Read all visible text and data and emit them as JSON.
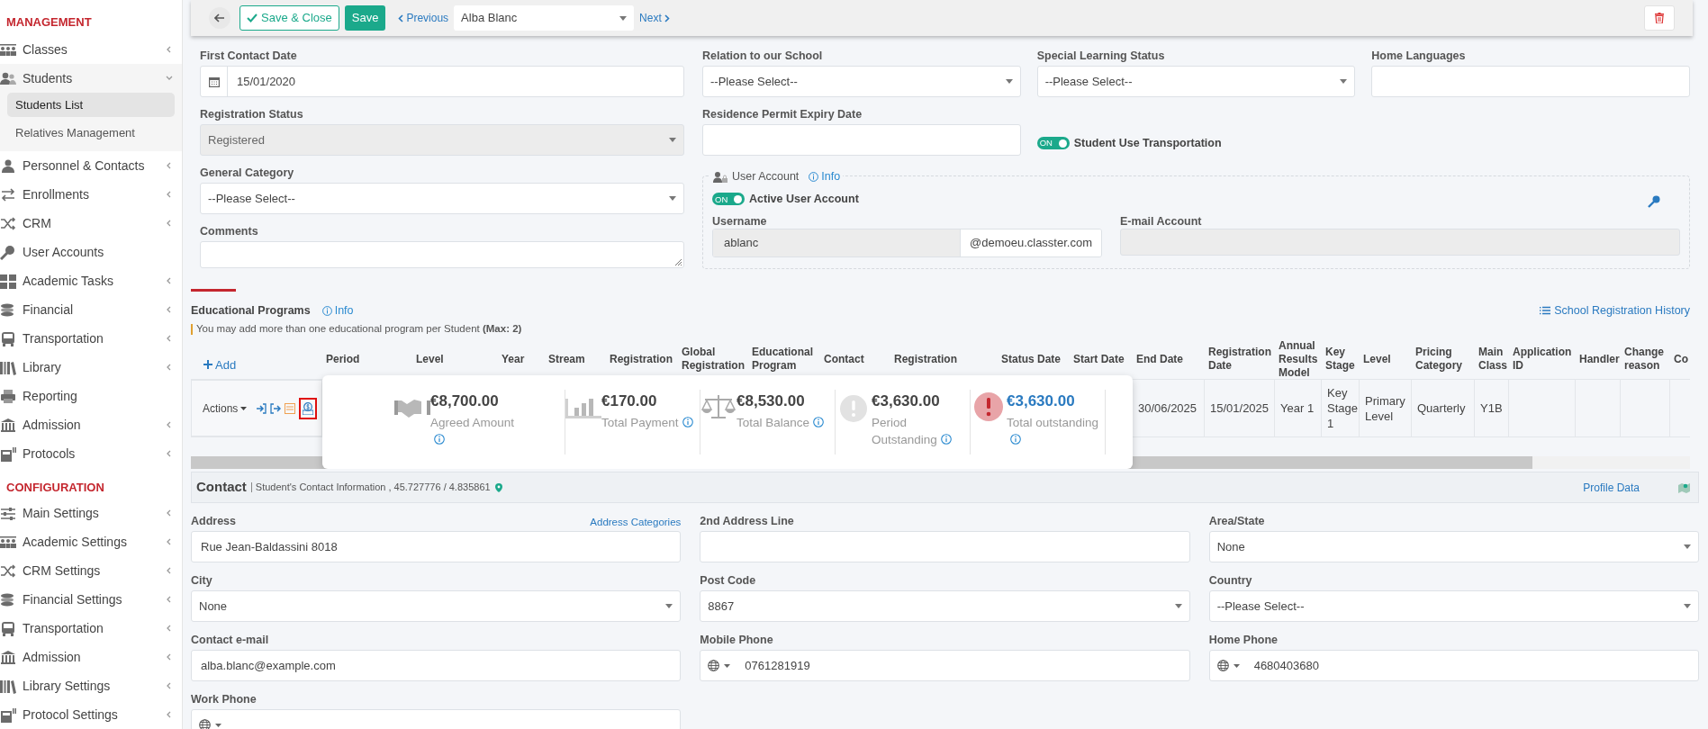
{
  "sidebar": {
    "sections": [
      {
        "heading": "MANAGEMENT",
        "items": [
          {
            "label": "Classes",
            "expandable": true,
            "expanded": false
          },
          {
            "label": "Students",
            "expandable": true,
            "expanded": true,
            "children": [
              {
                "label": "Students List",
                "selected": true
              },
              {
                "label": "Relatives Management",
                "selected": false
              }
            ]
          },
          {
            "label": "Personnel & Contacts",
            "expandable": true,
            "expanded": false
          },
          {
            "label": "Enrollments",
            "expandable": true,
            "expanded": false
          },
          {
            "label": "CRM",
            "expandable": true,
            "expanded": false
          },
          {
            "label": "User Accounts",
            "expandable": false
          },
          {
            "label": "Academic Tasks",
            "expandable": true,
            "expanded": false
          },
          {
            "label": "Financial",
            "expandable": true,
            "expanded": false
          },
          {
            "label": "Transportation",
            "expandable": true,
            "expanded": false
          },
          {
            "label": "Library",
            "expandable": true,
            "expanded": false
          },
          {
            "label": "Reporting",
            "expandable": false
          },
          {
            "label": "Admission",
            "expandable": true,
            "expanded": false
          },
          {
            "label": "Protocols",
            "expandable": true,
            "expanded": false
          }
        ]
      },
      {
        "heading": "CONFIGURATION",
        "items": [
          {
            "label": "Main Settings",
            "expandable": true,
            "expanded": false
          },
          {
            "label": "Academic Settings",
            "expandable": true,
            "expanded": false
          },
          {
            "label": "CRM Settings",
            "expandable": true,
            "expanded": false
          },
          {
            "label": "Financial Settings",
            "expandable": true,
            "expanded": false
          },
          {
            "label": "Transportation",
            "expandable": true,
            "expanded": false
          },
          {
            "label": "Admission",
            "expandable": true,
            "expanded": false
          },
          {
            "label": "Library Settings",
            "expandable": true,
            "expanded": false
          },
          {
            "label": "Protocol Settings",
            "expandable": true,
            "expanded": false
          }
        ]
      }
    ]
  },
  "toolbar": {
    "buttons": [
      {
        "label": "Save & Close",
        "kind": "outline"
      },
      {
        "label": "Save",
        "kind": "solid"
      }
    ],
    "previous": "Previous",
    "record": "Alba Blanc",
    "next": "Next"
  },
  "form": {
    "left": [
      {
        "label": "First Contact Date",
        "kind": "date",
        "value": "15/01/2020",
        "disabled": false
      },
      {
        "label": "Registration Status",
        "kind": "select",
        "value": "Registered",
        "disabled": true
      },
      {
        "label": "General Category",
        "kind": "select",
        "value": "--Please Select--",
        "disabled": false
      },
      {
        "label": "Comments",
        "kind": "textarea",
        "disabled": false
      }
    ],
    "row1": [
      {
        "label": "Relation to our School",
        "kind": "select",
        "value": "--Please Select--"
      },
      {
        "label": "Special Learning Status",
        "kind": "select",
        "value": "--Please Select--"
      },
      {
        "label": "Home Languages",
        "kind": "text"
      }
    ],
    "row2": [
      {
        "label": "Residence Permit Expiry Date",
        "kind": "text"
      },
      {
        "label": "Student Use Transportation",
        "kind": "toggle",
        "on": true,
        "toggle_text": "ON"
      }
    ],
    "user_account": {
      "legend": "User Account",
      "info": "Info",
      "active_label": "Active User Account",
      "active_on": true,
      "active_text": "ON",
      "username_label": "Username",
      "username": "ablanc",
      "domain": "@demoeu.classter.com",
      "email_label": "E-mail Account"
    }
  },
  "educational_programs": {
    "title": "Educational Programs",
    "info": "Info",
    "note": "You may add more than one educational program per Student **(Max: 2)**",
    "history_link": "School Registration History",
    "add": "Add",
    "actions": "Actions",
    "columns": [
      {
        "label": "Period"
      },
      {
        "label": "Level"
      },
      {
        "label": "Year"
      },
      {
        "label": "Stream"
      },
      {
        "label": "Registration"
      },
      {
        "label": "Global Registration"
      },
      {
        "label": "Educational Program"
      },
      {
        "label": "Contact"
      },
      {
        "label": "Registration"
      },
      {
        "label": "Status Date"
      },
      {
        "label": "Start Date"
      },
      {
        "label": "End Date",
        "cell": "30/06/2025"
      },
      {
        "label": "Registration Date",
        "cell": "15/01/2025"
      },
      {
        "label": "Annual Results Model",
        "cell": "Year 1"
      },
      {
        "label": "Key Stage",
        "cell": "Key Stage 1"
      },
      {
        "label": "Level",
        "cell": "Primary Level"
      },
      {
        "label": "Pricing Category",
        "cell": "Quarterly"
      },
      {
        "label": "Main Class",
        "cell": "Y1B"
      },
      {
        "label": "Application ID"
      },
      {
        "label": "Handler"
      },
      {
        "label": "Change reason"
      },
      {
        "label": "Co"
      }
    ],
    "popup": [
      {
        "amount": "€8,700.00",
        "label": "Agreed Amount",
        "kind": "neutral"
      },
      {
        "amount": "€170.00",
        "label": "Total Payment",
        "kind": "neutral"
      },
      {
        "amount": "€8,530.00",
        "label": "Total Balance",
        "kind": "neutral"
      },
      {
        "amount": "€3,630.00",
        "label": "Period Outstanding",
        "kind": "neutral"
      },
      {
        "amount": "€3,630.00",
        "label": "Total outstanding",
        "kind": "alert"
      }
    ]
  },
  "contact": {
    "title": "Contact",
    "subtitle": "Student's Contact Information , 45.727776 / 4.835861",
    "profile_link": "Profile Data",
    "fields": [
      {
        "label": "Address",
        "kind": "text",
        "value": "Rue Jean-Baldassini 8018",
        "link": "Address Categories"
      },
      {
        "label": "2nd Address Line",
        "kind": "text"
      },
      {
        "label": "Area/State",
        "kind": "select",
        "value": "None"
      },
      {
        "label": "City",
        "kind": "select",
        "value": "None"
      },
      {
        "label": "Post Code",
        "kind": "select",
        "value": "8867"
      },
      {
        "label": "Country",
        "kind": "select",
        "value": "--Please Select--"
      },
      {
        "label": "Contact e-mail",
        "kind": "text",
        "value": "alba.blanc@example.com"
      },
      {
        "label": "Mobile Phone",
        "kind": "phone",
        "value": "0761281919"
      },
      {
        "label": "Home Phone",
        "kind": "phone",
        "value": "4680403680"
      },
      {
        "label": "Work Phone",
        "kind": "phone"
      }
    ]
  }
}
